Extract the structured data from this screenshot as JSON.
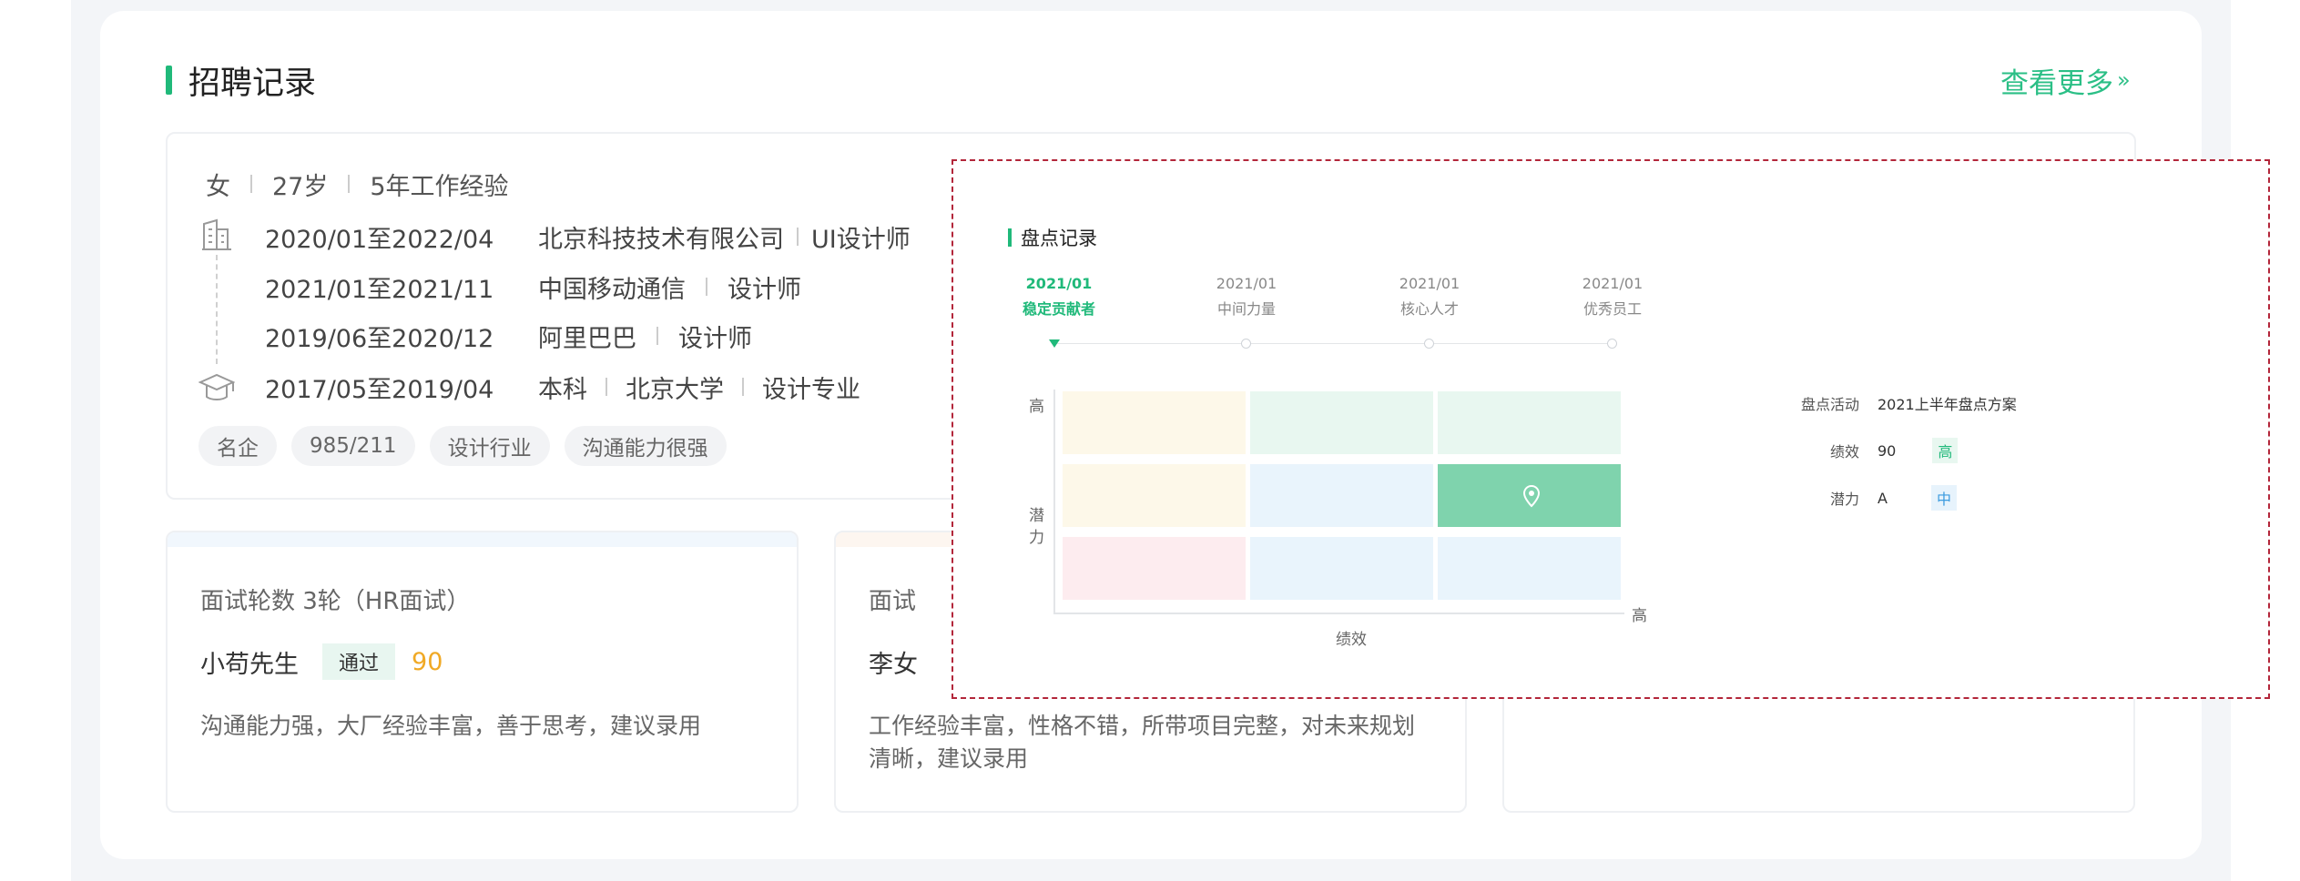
{
  "section": {
    "title": "招聘记录",
    "more_label": "查看更多",
    "more_arrow": "»"
  },
  "candidate": {
    "gender": "女",
    "age": "27岁",
    "experience": "5年工作经验"
  },
  "work_history": [
    {
      "date": "2020/01至2022/04",
      "company": "北京科技技术有限公司",
      "role": "UI设计师"
    },
    {
      "date": "2021/01至2021/11",
      "company": "中国移动通信",
      "role": "设计师"
    },
    {
      "date": "2019/06至2020/12",
      "company": "阿里巴巴",
      "role": "设计师"
    }
  ],
  "education": {
    "date": "2017/05至2019/04",
    "degree": "本科",
    "school": "北京大学",
    "major": "设计专业"
  },
  "tags": [
    "名企",
    "985/211",
    "设计行业",
    "沟通能力很强"
  ],
  "interviews": [
    {
      "rounds": "面试轮数  3轮（HR面试）",
      "interviewer": "小苟先生",
      "result": "通过",
      "score": "90",
      "comment": "沟通能力强，大厂经验丰富，善于思考，建议录用"
    },
    {
      "rounds": "面试",
      "interviewer": "李女",
      "comment": "工作经验丰富，性格不错，所带项目完整，对未来规划清晰，建议录用"
    }
  ],
  "inventory": {
    "title": "盘点记录",
    "timeline": [
      {
        "date": "2021/01",
        "label": "稳定贡献者",
        "active": true
      },
      {
        "date": "2021/01",
        "label": "中间力量",
        "active": false
      },
      {
        "date": "2021/01",
        "label": "核心人才",
        "active": false
      },
      {
        "date": "2021/01",
        "label": "优秀员工",
        "active": false
      }
    ],
    "grid": {
      "y_high": "高",
      "y_label_1": "潜",
      "y_label_2": "力",
      "x_high": "高",
      "x_label": "绩效",
      "cells": [
        [
          "#fdf8e9",
          "#e8f7f0",
          "#e8f7f0"
        ],
        [
          "#fdf8e9",
          "#e9f4fc",
          "#7fd3ad"
        ],
        [
          "#fdecef",
          "#e9f4fc",
          "#e9f4fc"
        ]
      ],
      "marker_row": 1,
      "marker_col": 2
    },
    "details": {
      "activity_label": "盘点活动",
      "activity_value": "2021上半年盘点方案",
      "perf_label": "绩效",
      "perf_value": "90",
      "perf_badge": "高",
      "potential_label": "潜力",
      "potential_value": "A",
      "potential_badge": "中"
    }
  },
  "colors": {
    "accent": "#20b97a",
    "link": "#2bbf86",
    "score": "#f0a925",
    "overlay_border": "#b3263a",
    "badge_high_bg": "#e8f7f0",
    "badge_mid_bg": "#e7f3fc",
    "badge_mid_fg": "#3b9be0"
  }
}
